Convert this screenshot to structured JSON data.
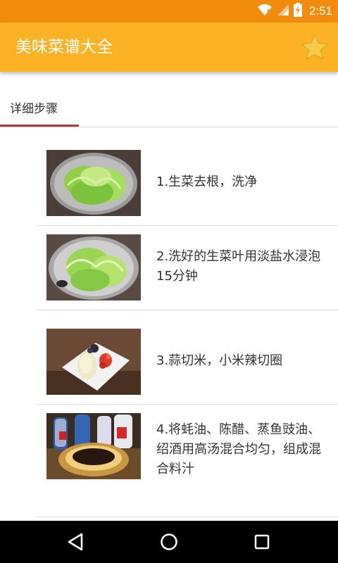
{
  "status_bar": {
    "time": "2:51"
  },
  "app_bar": {
    "title": "美味菜谱大全"
  },
  "tab": {
    "label": "详细步骤"
  },
  "steps": [
    {
      "text": "1.生菜去根，洗净",
      "image": "lettuce-in-bowl"
    },
    {
      "text": "2.洗好的生菜叶用淡盐水浸泡15分钟",
      "image": "lettuce-soaking"
    },
    {
      "text": "3.蒜切米，小米辣切圈",
      "image": "garlic-chili-plate"
    },
    {
      "text": "4.将蚝油、陈醋、蒸鱼豉油、绍酒用高汤混合均匀，组成混合料汁",
      "image": "sauce-bottles-dish"
    }
  ],
  "colors": {
    "status_bar": "#f28c0f",
    "app_bar": "#fbb325",
    "tab_indicator": "#b83b3b",
    "star": "#f7c948"
  }
}
